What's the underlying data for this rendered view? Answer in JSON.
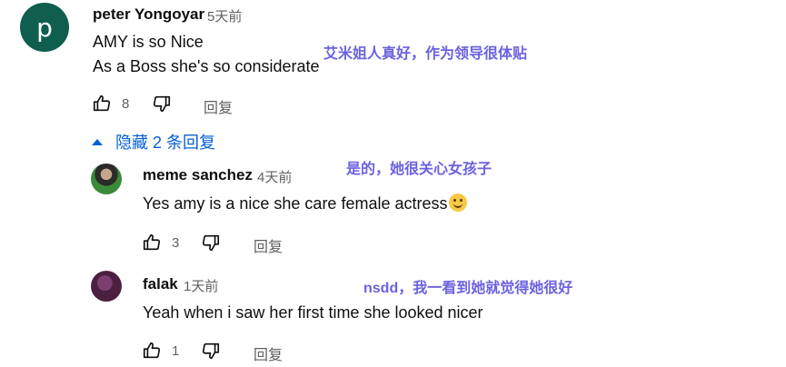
{
  "comments": [
    {
      "avatar_letter": "p",
      "avatar_color": "#0f5e4e",
      "author": "peter Yongoyar",
      "time": "5天前",
      "lines": [
        "AMY is so Nice",
        "As a Boss she's so considerate"
      ],
      "translation_note": "艾米姐人真好，作为领导很体贴",
      "likes": "8",
      "reply_label": "回复"
    }
  ],
  "toggle_replies": {
    "label": "隐藏 2 条回复",
    "color": "#065fd4"
  },
  "replies": [
    {
      "author": "meme sanchez",
      "time": "4天前",
      "text": "Yes amy is a nice she care female actress",
      "emoji": "smiling-face",
      "translation_note": "是的，她很关心女孩子",
      "likes": "3",
      "reply_label": "回复"
    },
    {
      "author": "falak",
      "time": "1天前",
      "text": "Yeah when i saw her first time she looked nicer",
      "translation_note": "nsdd，我一看到她就觉得她很好",
      "likes": "1",
      "reply_label": "回复"
    }
  ],
  "note_color": "#6b62e0",
  "icons": {
    "like": "thumbs-up-icon",
    "dislike": "thumbs-down-icon",
    "collapse": "caret-up-icon"
  }
}
